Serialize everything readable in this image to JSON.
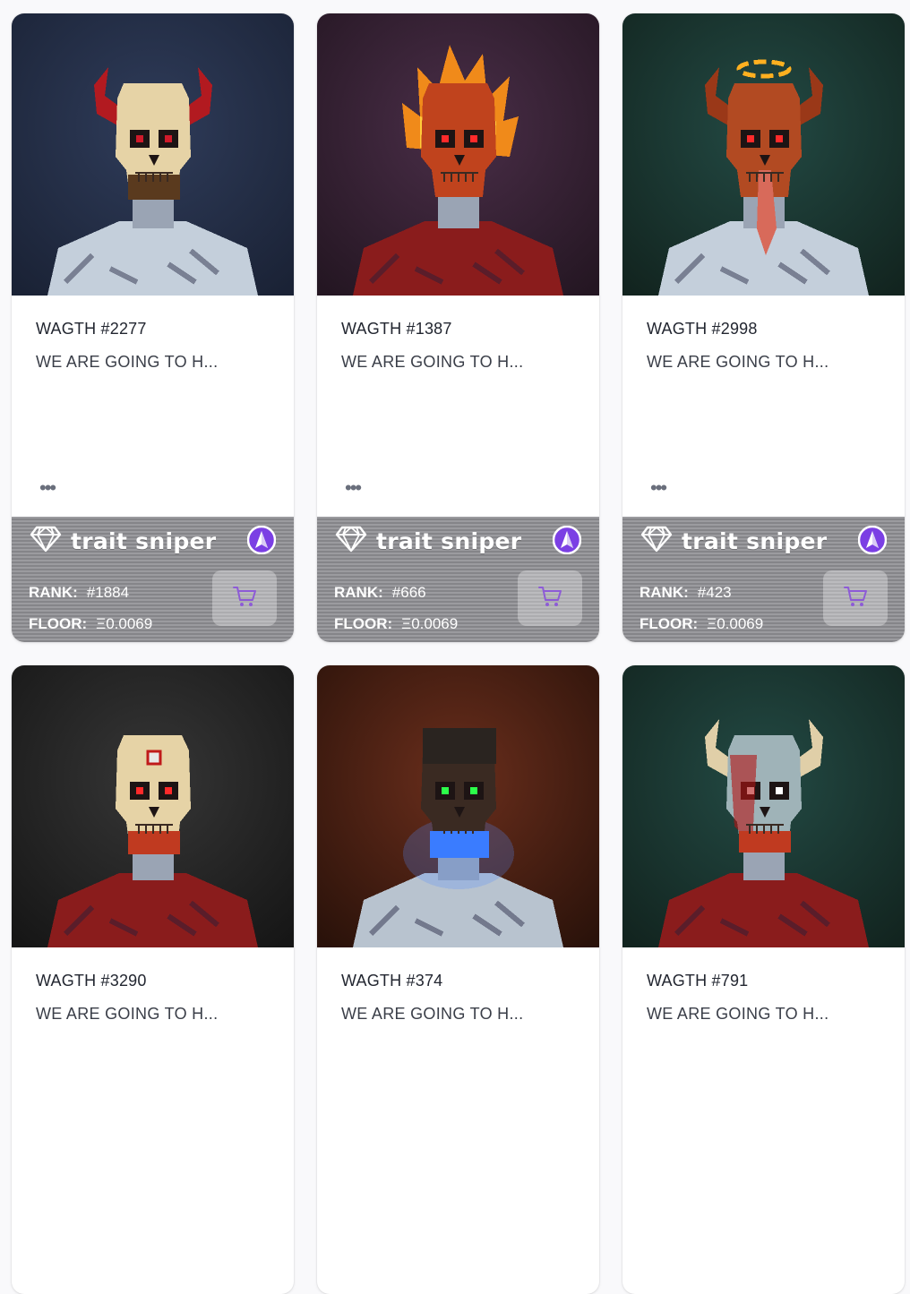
{
  "brand": {
    "name": "trait sniper"
  },
  "labels": {
    "rank": "RANK:",
    "floor": "FLOOR:",
    "more": "•••"
  },
  "colors": {
    "accent_purple": "#7b3fe4",
    "cart_purple": "#8d5bd6"
  },
  "cards": [
    {
      "name": "WAGTH #2277",
      "description": "WE ARE GOING TO H...",
      "rank": "#1884",
      "floor": "Ξ0.0069",
      "art": {
        "bg1": "#2f3c5a",
        "bg2": "#1a2235",
        "skull": "#e6d3a6",
        "eyes": "#d01a2a",
        "horns": "#b21a20",
        "shirt": "#c4cfdb",
        "extra": "beard"
      }
    },
    {
      "name": "WAGTH #1387",
      "description": "WE ARE GOING TO H...",
      "rank": "#666",
      "floor": "Ξ0.0069",
      "art": {
        "bg1": "#4a2e48",
        "bg2": "#241622",
        "skull": "#c0431d",
        "eyes": "#ff2a2a",
        "horns": "none",
        "shirt": "#8a1c1c",
        "extra": "flames"
      }
    },
    {
      "name": "WAGTH #2998",
      "description": "WE ARE GOING TO H...",
      "rank": "#423",
      "floor": "Ξ0.0069",
      "art": {
        "bg1": "#234a44",
        "bg2": "#12241f",
        "skull": "#b24a22",
        "eyes": "#ff2a2a",
        "horns": "#9a3818",
        "shirt": "#c4cfdb",
        "extra": "halo"
      }
    },
    {
      "name": "WAGTH #3290",
      "description": "WE ARE GOING TO H...",
      "rank": "",
      "floor": "",
      "art": {
        "bg1": "#363636",
        "bg2": "#161616",
        "skull": "#e6d3a6",
        "eyes": "#ff2a2a",
        "horns": "none",
        "shirt": "#8a1c1c",
        "extra": "jaw"
      }
    },
    {
      "name": "WAGTH #374",
      "description": "WE ARE GOING TO H...",
      "rank": "",
      "floor": "",
      "art": {
        "bg1": "#6a2e1c",
        "bg2": "#2a120a",
        "skull": "#3a2a22",
        "eyes": "#2cff4a",
        "horns": "none",
        "shirt": "#b8c3cf",
        "extra": "bluejaw"
      }
    },
    {
      "name": "WAGTH #791",
      "description": "WE ARE GOING TO H...",
      "rank": "",
      "floor": "",
      "art": {
        "bg1": "#234a44",
        "bg2": "#12241f",
        "skull": "#9fb3b8",
        "eyes": "#ffffff",
        "horns": "#e0cfa8",
        "shirt": "#8a1c1c",
        "extra": "blood"
      }
    }
  ]
}
